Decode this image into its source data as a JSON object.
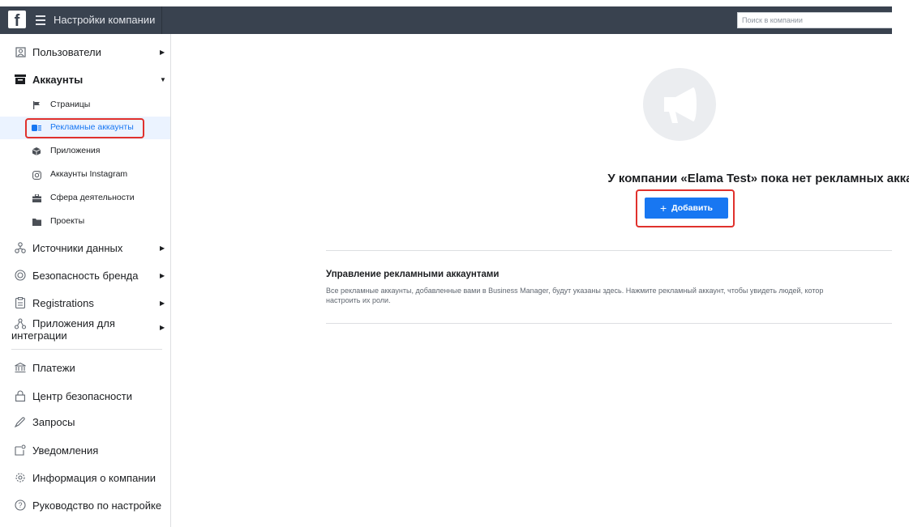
{
  "header": {
    "logo": "f",
    "title": "Настройки компании",
    "search_placeholder": "Поиск в компании"
  },
  "sidebar": {
    "items": [
      {
        "label": "Пользователи",
        "icon": "users-icon"
      },
      {
        "label": "Аккаунты",
        "icon": "accounts-icon"
      },
      {
        "label": "Источники данных",
        "icon": "data-sources-icon"
      },
      {
        "label": "Безопасность бренда",
        "icon": "brand-safety-icon"
      },
      {
        "label": "Registrations",
        "icon": "registrations-icon"
      },
      {
        "label": "Приложения для интеграции",
        "icon": "integrations-icon"
      },
      {
        "label": "Платежи",
        "icon": "payments-icon"
      },
      {
        "label": "Центр безопасности",
        "icon": "lock-icon"
      },
      {
        "label": "Запросы",
        "icon": "requests-icon"
      },
      {
        "label": "Уведомления",
        "icon": "notifications-icon"
      },
      {
        "label": "Информация о компании",
        "icon": "gear-icon"
      },
      {
        "label": "Руководство по настройке",
        "icon": "help-icon"
      }
    ],
    "sub_items": [
      {
        "label": "Страницы",
        "icon": "flag-icon"
      },
      {
        "label": "Рекламные аккаунты",
        "icon": "ad-account-icon",
        "active": true
      },
      {
        "label": "Приложения",
        "icon": "cube-icon"
      },
      {
        "label": "Аккаунты Instagram",
        "icon": "instagram-icon"
      },
      {
        "label": "Сфера деятельности",
        "icon": "briefcase-icon"
      },
      {
        "label": "Проекты",
        "icon": "folder-icon"
      }
    ]
  },
  "main": {
    "empty_message": "У компании «Elama Test» пока нет рекламных аккаунтов.",
    "add_button": "Добавить",
    "section_title": "Управление рекламными аккаунтами",
    "section_desc_line1": "Все рекламные аккаунты, добавленные вами в Business Manager, будут указаны здесь. Нажмите рекламный аккаунт, чтобы увидеть людей, котор",
    "section_desc_line2": "настроить их роли."
  },
  "colors": {
    "topbar": "#39424f",
    "accent": "#1877f2",
    "highlight": "#e0312d",
    "active_bg": "#ebf3ff"
  }
}
